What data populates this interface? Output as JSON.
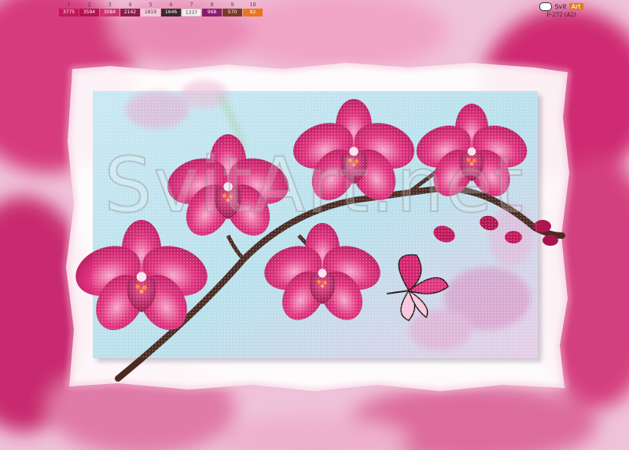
{
  "palette": {
    "swatches": [
      {
        "num": "1",
        "code": "3775",
        "color": "#c2185b"
      },
      {
        "num": "2",
        "code": "3594",
        "color": "#b0154f"
      },
      {
        "num": "3",
        "code": "3084",
        "color": "#d0326f"
      },
      {
        "num": "4",
        "code": "2142",
        "color": "#8e1a4a"
      },
      {
        "num": "5",
        "code": "1819",
        "color": "#f6c6d9"
      },
      {
        "num": "6",
        "code": "1646",
        "color": "#3a2a2a"
      },
      {
        "num": "7",
        "code": "1337",
        "color": "#f4eef2"
      },
      {
        "num": "8",
        "code": "968",
        "color": "#8a1c6e"
      },
      {
        "num": "9",
        "code": "570",
        "color": "#7a3a2a"
      },
      {
        "num": "10",
        "code": "82",
        "color": "#e8761c"
      }
    ]
  },
  "brand": {
    "svit": "Svit",
    "art": "Art",
    "product_code": "F-272  (A2)",
    "accent": "#e07a1d"
  },
  "watermark": "SvitArt.net",
  "colors": {
    "petal": "#d4236f",
    "petal_dark": "#a8134f",
    "petal_light": "#f27bb0",
    "stem": "#4a2a22",
    "sky": "#bfe3ee",
    "frame": "#ffffff"
  }
}
